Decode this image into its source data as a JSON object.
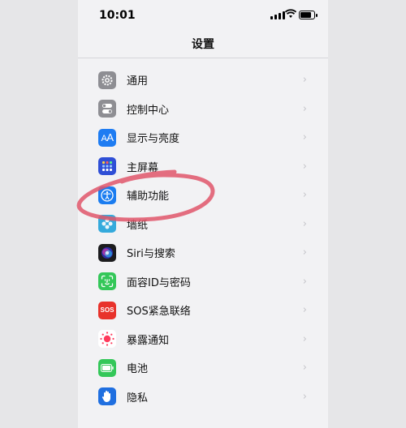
{
  "status_bar": {
    "time": "10:01"
  },
  "nav": {
    "title": "设置"
  },
  "items": [
    {
      "label": "通用",
      "icon": "gear-icon",
      "color": "#8e8e93"
    },
    {
      "label": "控制中心",
      "icon": "toggles-icon",
      "color": "#8e8e93"
    },
    {
      "label": "显示与亮度",
      "icon": "text-size-icon",
      "color": "#1e7cf2"
    },
    {
      "label": "主屏幕",
      "icon": "home-grid-icon",
      "color": "#2f4fd6"
    },
    {
      "label": "辅助功能",
      "icon": "accessibility-icon",
      "color": "#1a7cf0"
    },
    {
      "label": "墙纸",
      "icon": "flower-icon",
      "color": "#35aadc"
    },
    {
      "label": "Siri与搜索",
      "icon": "siri-icon",
      "color": "#1c1c1e"
    },
    {
      "label": "面容ID与密码",
      "icon": "face-id-icon",
      "color": "#34c759"
    },
    {
      "label": "SOS紧急联络",
      "icon": "sos-icon",
      "color": "#e8322b"
    },
    {
      "label": "暴露通知",
      "icon": "exposure-icon",
      "color": "#ffffff"
    },
    {
      "label": "电池",
      "icon": "battery-icon",
      "color": "#34c759"
    },
    {
      "label": "隐私",
      "icon": "hand-icon",
      "color": "#1f6fe0"
    }
  ],
  "annotation": {
    "color": "#e0566a"
  }
}
